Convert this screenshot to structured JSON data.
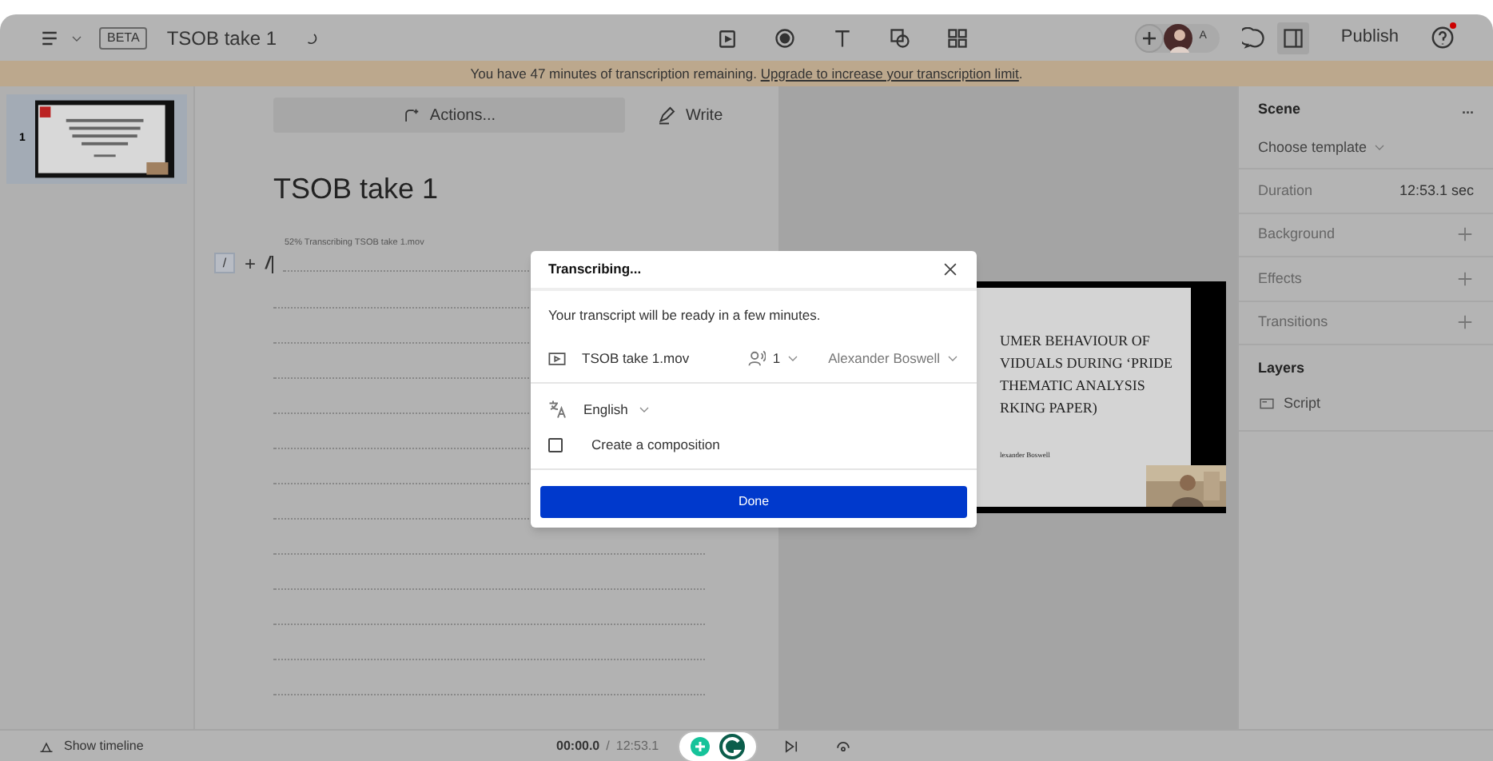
{
  "top_bar": {
    "badge": "BETA",
    "project_title": "TSOB take 1",
    "publish": "Publish",
    "avatar_initial": "A",
    "help_notification": true
  },
  "banner": {
    "text": "You have 47 minutes of transcription remaining. ",
    "link": "Upgrade to increase your transcription limit",
    "end": "."
  },
  "scenes": [
    {
      "number": "1",
      "selected": true
    }
  ],
  "editor": {
    "actions": "Actions...",
    "write": "Write",
    "title": "TSOB take 1",
    "progress_note": "52% Transcribing TSOB take 1.mov",
    "slash": "/",
    "plus": "+",
    "cursor_text": "/"
  },
  "preview": {
    "slide_lines": [
      "UMER BEHAVIOUR OF",
      "VIDUALS DURING ‘PRIDE",
      "THEMATIC ANALYSIS",
      "RKING PAPER)"
    ],
    "author": "lexander Boswell"
  },
  "dialog": {
    "title": "Transcribing...",
    "message": "Your transcript will be ready in a few minutes.",
    "file": "TSOB take 1.mov",
    "speakers": "1",
    "speaker_name": "Alexander Boswell",
    "language": "English",
    "composition": {
      "label": "Create a composition",
      "checked": false
    },
    "done": "Done"
  },
  "properties": {
    "scene": "Scene",
    "more": "...",
    "template": "Choose template",
    "rows": [
      {
        "label": "Duration",
        "value": "12:53.1 sec",
        "kind": "value"
      },
      {
        "label": "Background",
        "kind": "add"
      },
      {
        "label": "Effects",
        "kind": "add"
      },
      {
        "label": "Transitions",
        "kind": "add"
      }
    ],
    "layers_title": "Layers",
    "layers": [
      {
        "name": "Script"
      }
    ]
  },
  "bottom_bar": {
    "show_timeline": "Show timeline",
    "current_time": "00:00.0",
    "separator": "/",
    "total_time": "12:53.1"
  }
}
